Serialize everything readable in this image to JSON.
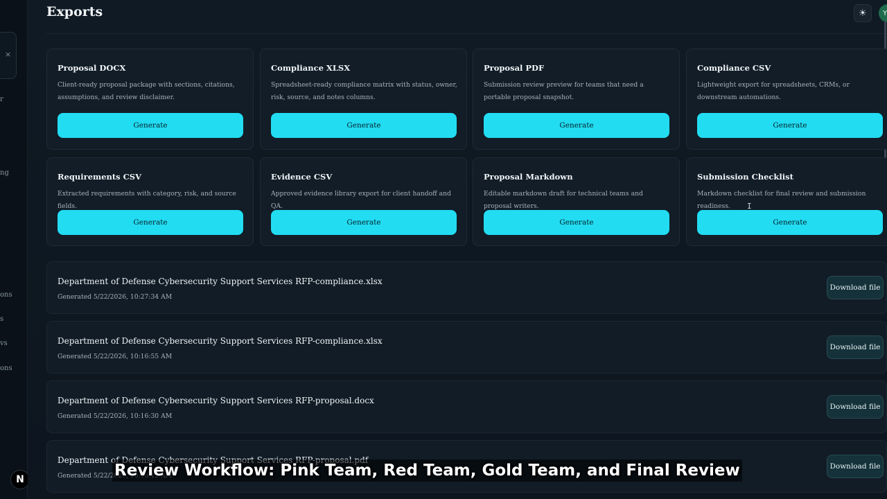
{
  "page": {
    "title": "Exports"
  },
  "header": {
    "theme_icon": "☀",
    "avatar_initial": "Y"
  },
  "sidebar": {
    "close_icon": "×",
    "fragments": [
      "r",
      "ng",
      "ons",
      "s",
      "vs",
      "ons"
    ],
    "badge": "N"
  },
  "cards": [
    {
      "title": "Proposal DOCX",
      "desc": "Client-ready proposal package with sections, citations, assumptions, and review disclaimer.",
      "button": "Generate"
    },
    {
      "title": "Compliance XLSX",
      "desc": "Spreadsheet-ready compliance matrix with status, owner, risk, source, and notes columns.",
      "button": "Generate"
    },
    {
      "title": "Proposal PDF",
      "desc": "Submission review preview for teams that need a portable proposal snapshot.",
      "button": "Generate"
    },
    {
      "title": "Compliance CSV",
      "desc": "Lightweight export for spreadsheets, CRMs, or downstream automations.",
      "button": "Generate"
    },
    {
      "title": "Requirements CSV",
      "desc": "Extracted requirements with category, risk, and source fields.",
      "button": "Generate"
    },
    {
      "title": "Evidence CSV",
      "desc": "Approved evidence library export for client handoff and QA.",
      "button": "Generate"
    },
    {
      "title": "Proposal Markdown",
      "desc": "Editable markdown draft for technical teams and proposal writers.",
      "button": "Generate"
    },
    {
      "title": "Submission Checklist",
      "desc": "Markdown checklist for final review and submission readiness.",
      "button": "Generate"
    }
  ],
  "files": [
    {
      "name": "Department of Defense Cybersecurity Support Services RFP-compliance.xlsx",
      "date": "Generated 5/22/2026, 10:27:34 AM",
      "button": "Download file"
    },
    {
      "name": "Department of Defense Cybersecurity Support Services RFP-compliance.xlsx",
      "date": "Generated 5/22/2026, 10:16:55 AM",
      "button": "Download file"
    },
    {
      "name": "Department of Defense Cybersecurity Support Services RFP-proposal.docx",
      "date": "Generated 5/22/2026, 10:16:30 AM",
      "button": "Download file"
    },
    {
      "name": "Department of Defense Cybersecurity Support Services RFP-proposal.pdf",
      "date": "Generated 5/22/2026, 10:16:15 AM",
      "button": "Download file"
    }
  ],
  "caption": "Review Workflow: Pink Team, Red Team, Gold Team, and Final Review",
  "colors": {
    "accent": "#22dcf2",
    "background": "#0c141c"
  }
}
